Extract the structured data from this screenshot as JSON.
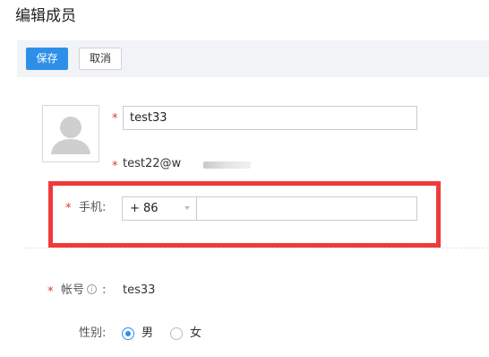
{
  "page": {
    "title": "编辑成员"
  },
  "toolbar": {
    "save_label": "保存",
    "cancel_label": "取消"
  },
  "form": {
    "required_mark": "*",
    "name_value": "test33",
    "email_text": "test22@w",
    "phone": {
      "label": "手机:",
      "country_code": "+ 86",
      "number_value": ""
    },
    "account": {
      "label": "帐号",
      "info_icon": "i",
      "colon": ":",
      "value": "tes33"
    },
    "gender": {
      "label": "性别:",
      "options": [
        "男",
        "女"
      ],
      "selected": "男"
    }
  },
  "colors": {
    "primary": "#2e8fe8",
    "required": "#d33b3b",
    "highlight_box": "#f03a3a"
  },
  "icons": [
    "avatar-placeholder-icon",
    "info-icon",
    "chevron-down-icon"
  ]
}
